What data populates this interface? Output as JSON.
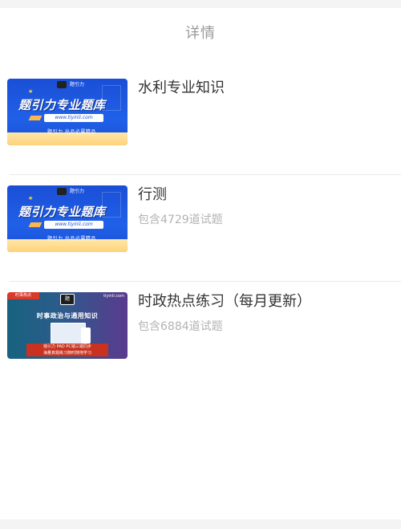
{
  "header": {
    "title": "详情"
  },
  "items": [
    {
      "title": "水利专业知识",
      "subtitle": "",
      "thumb": {
        "type": "A",
        "headline": "题引力专业题库",
        "url": "www.tiyinli.com",
        "tagline": "题引力 出品必属精品",
        "logo_text": "题引力"
      }
    },
    {
      "title": "行测",
      "subtitle": "包含4729道试题",
      "thumb": {
        "type": "A",
        "headline": "题引力专业题库",
        "url": "www.tiyinli.com",
        "tagline": "题引力 出品必属精品",
        "logo_text": "题引力"
      }
    },
    {
      "title": "时政热点练习（每月更新）",
      "subtitle": "包含6884道试题",
      "thumb": {
        "type": "B",
        "tag": "时事热点",
        "headline": "时事政治与通用知识",
        "site": "tiyinli.com",
        "logo_text": "题",
        "box_line1": "题引力 PAD PC端三端同步",
        "box_line2": "海量真题练习随时随地学习"
      }
    }
  ],
  "colors": {
    "title": "#333333",
    "subtitle": "#b3b3b3",
    "header": "#999999",
    "thumbA_blue": "#1a4fd6"
  }
}
